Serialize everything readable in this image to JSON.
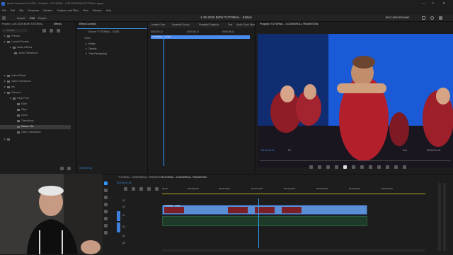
{
  "app": {
    "title": "Adobe Premiere Pro 2025 - C:\\Users\\...\\TUTORIAL - 3-25-2025 BOW TUTORIAL.prproj",
    "window_title": "1-25-2025 BOW TUTORIAL - Edited",
    "account": "BECCARE BROWNE"
  },
  "menu": [
    "File",
    "Edit",
    "Clip",
    "Sequence",
    "Markers",
    "Graphics and Titles",
    "View",
    "Window",
    "Help"
  ],
  "top_tabs": [
    "Import",
    "Edit",
    "Export"
  ],
  "workspace_tabs": [
    "Effect Controls",
    "Lumetri Color",
    "Essential Sound",
    "Essential Graphics",
    "Text",
    "Audio Track Mixer"
  ],
  "project_panel": {
    "title": "Project: 1-25-2025 BOW TUTORIAL",
    "tabs": [
      "Effects"
    ],
    "search_placeholder": "Search",
    "tree": [
      {
        "label": "Presets",
        "indent": 1,
        "icon": "folder-icon"
      },
      {
        "label": "Lumetri Presets",
        "indent": 1,
        "icon": "folder-icon"
      },
      {
        "label": "Audio Effects",
        "indent": 1,
        "icon": "folder-icon"
      },
      {
        "label": "Audio Transitions",
        "indent": 1,
        "icon": "folder-icon"
      },
      {
        "label": "Video Effects",
        "indent": 1,
        "icon": "folder-icon"
      },
      {
        "label": "Video Transitions",
        "indent": 1,
        "icon": "folder-icon"
      },
      {
        "label": "Iris",
        "indent": 2,
        "icon": "folder-icon"
      },
      {
        "label": "Dissolve",
        "indent": 2,
        "icon": "folder-icon"
      },
      {
        "label": "Page Peel",
        "indent": 2,
        "icon": "folder-icon"
      },
      {
        "label": "Slide",
        "indent": 2,
        "icon": "folder-icon"
      },
      {
        "label": "Wipe",
        "indent": 2,
        "icon": "folder-icon"
      },
      {
        "label": "Zoom",
        "indent": 2,
        "icon": "folder-icon"
      },
      {
        "label": "Transitions",
        "indent": 2,
        "icon": "folder-icon",
        "selected": true
      },
      {
        "label": "Motion Tile",
        "indent": 2,
        "icon": "folder-icon"
      },
      {
        "label": "Video Transitions",
        "indent": 1,
        "icon": "folder-icon"
      }
    ]
  },
  "effect_controls": {
    "title": "Effect Controls",
    "source": "Source * TUTORIAL - COOK",
    "items": [
      "Video",
      "Motion",
      "Opacity",
      "Time Remapping"
    ],
    "timecode": "00:00:05:12"
  },
  "source_timeline": {
    "timecodes": [
      "00:00:02:12",
      "00:00:04:12",
      "00:00:06:12"
    ],
    "clip_label": "TUTORIAL - COOK"
  },
  "program_monitor": {
    "title": "Program: TUTORIAL - COOKIEROLL TRANSITION",
    "timecode_left": "00:00:01:11",
    "fit": "Fit",
    "quality": "Full",
    "timecode_right": "00:00:51:10"
  },
  "timeline": {
    "tabs": [
      "TUTORIAL - COOKIEROLL TRANSITION",
      "TUTORIAL - COOKIEROLL TRANSITION"
    ],
    "timecode": "00:00:01:11",
    "ruler": [
      "00:00",
      "00:00:05:00",
      "00:00:10:00",
      "00:00:15:00",
      "00:00:20:00",
      "00:00:25:00",
      "00:00:30:00",
      "00:00:35:00"
    ],
    "tracks": [
      "V3",
      "V2",
      "V1",
      "A1",
      "A2",
      "A3"
    ],
    "clips": [
      {
        "label": "TUTORIAL - COOK",
        "track": "V1"
      }
    ]
  },
  "colors": {
    "accent": "#2e9bff",
    "clip": "#5a8fd6",
    "audio_clip": "#2f5a3a",
    "bg": "#1a1a1a"
  }
}
